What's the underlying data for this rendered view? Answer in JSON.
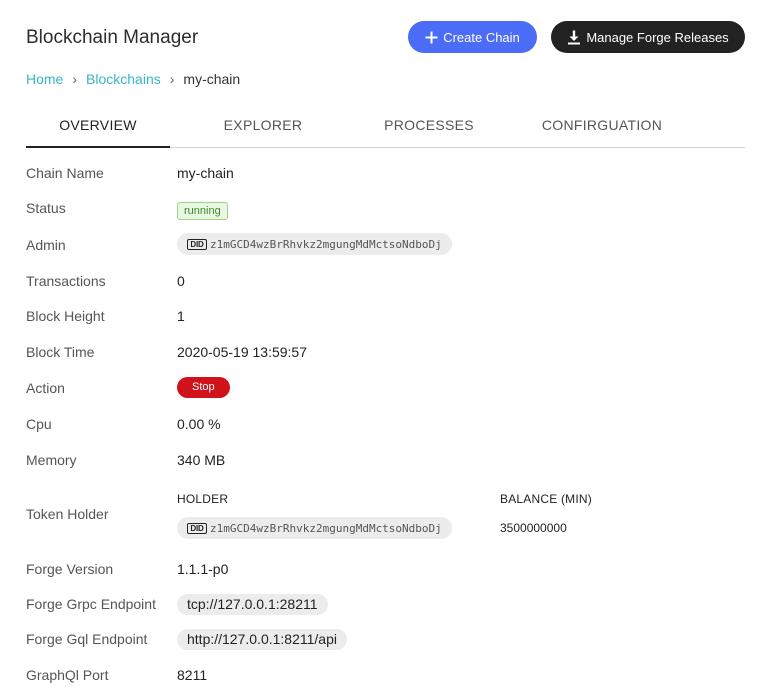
{
  "header": {
    "title": "Blockchain Manager",
    "create_label": "Create Chain",
    "forge_label": "Manage Forge Releases"
  },
  "breadcrumb": {
    "home": "Home",
    "blockchains": "Blockchains",
    "current": "my-chain",
    "separator": "›"
  },
  "tabs": [
    "OVERVIEW",
    "EXPLORER",
    "PROCESSES",
    "CONFIRGUATION"
  ],
  "details": {
    "chain_name": {
      "label": "Chain Name",
      "value": "my-chain"
    },
    "status": {
      "label": "Status",
      "value": "running"
    },
    "admin": {
      "label": "Admin",
      "did_icon": "DID",
      "value": "z1mGCD4wzBrRhvkz2mgungMdMctsoNdboDj"
    },
    "transactions": {
      "label": "Transactions",
      "value": "0"
    },
    "block_height": {
      "label": "Block Height",
      "value": "1"
    },
    "block_time": {
      "label": "Block Time",
      "value": "2020-05-19 13:59:57"
    },
    "action": {
      "label": "Action",
      "value": "Stop"
    },
    "cpu": {
      "label": "Cpu",
      "value": "0.00 %"
    },
    "memory": {
      "label": "Memory",
      "value": "340 MB"
    },
    "token_holder": {
      "label": "Token Holder",
      "columns": [
        "HOLDER",
        "BALANCE (MIN)"
      ],
      "rows": [
        {
          "did_icon": "DID",
          "holder": "z1mGCD4wzBrRhvkz2mgungMdMctsoNdboDj",
          "balance": "3500000000"
        }
      ]
    },
    "forge_version": {
      "label": "Forge Version",
      "value": "1.1.1-p0"
    },
    "grpc_endpoint": {
      "label": "Forge Grpc Endpoint",
      "value": "tcp://127.0.0.1:28211"
    },
    "gql_endpoint": {
      "label": "Forge Gql Endpoint",
      "value": "http://127.0.0.1:8211/api"
    },
    "graphql_port": {
      "label": "GraphQl Port",
      "value": "8211"
    }
  },
  "colors": {
    "primary": "#4a6cf7",
    "dark_button": "#222222",
    "link": "#3ab5c8",
    "running": "#3a8a2a",
    "stop": "#d0121b"
  },
  "icons": {
    "create": "plus-icon",
    "forge": "download-icon",
    "did": "did-icon"
  }
}
